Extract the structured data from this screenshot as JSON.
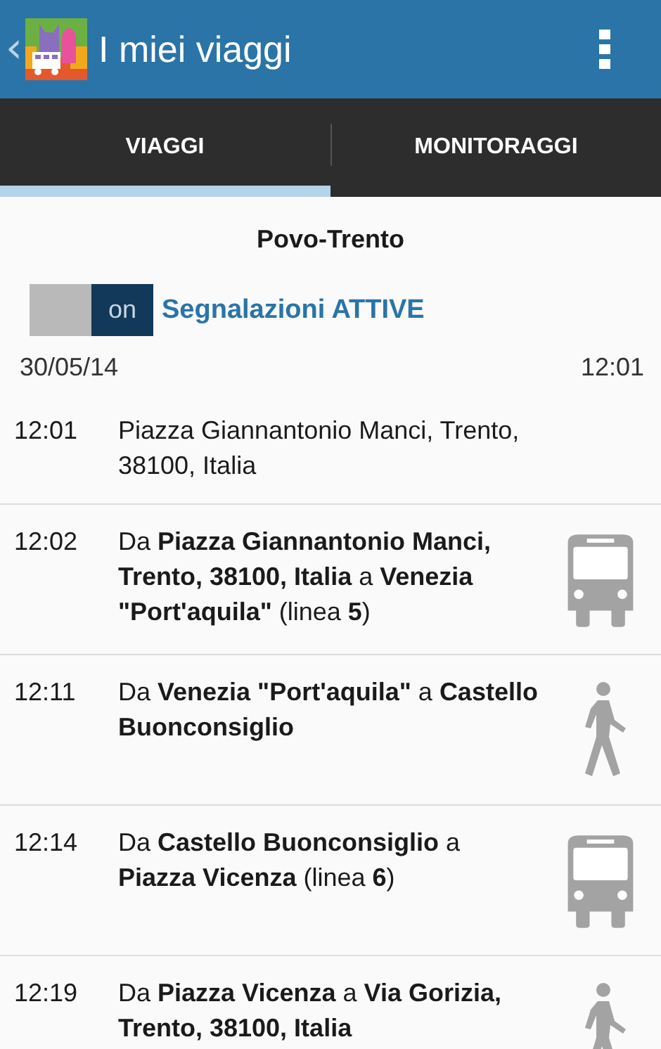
{
  "app_bar": {
    "back": "‹",
    "title": "I miei viaggi"
  },
  "tabs": [
    {
      "label": "VIAGGI",
      "selected": true
    },
    {
      "label": "MONITORAGGI",
      "selected": false
    }
  ],
  "trip": {
    "title": "Povo-Trento",
    "alerts": {
      "on": true,
      "switch_label": "on",
      "label": "Segnalazioni ATTIVE"
    },
    "date": "30/05/14",
    "time": "12:01"
  },
  "steps": [
    {
      "time": "12:01",
      "kind": "start",
      "text": "Piazza Giannantonio Manci, Trento, 38100, Italia"
    },
    {
      "time": "12:02",
      "kind": "bus",
      "text": "Da **Piazza Giannantonio Manci, Trento, 38100, Italia** a **Venezia \"Port'aquila\"** (linea **5**)"
    },
    {
      "time": "12:11",
      "kind": "walk",
      "text": "Da **Venezia \"Port'aquila\"** a **Castello Buonconsiglio**"
    },
    {
      "time": "12:14",
      "kind": "bus",
      "text": "Da **Castello Buonconsiglio** a **Piazza Vicenza** (linea **6**)"
    },
    {
      "time": "12:19",
      "kind": "walk",
      "text": "Da **Piazza Vicenza** a **Via Gorizia, Trento, 38100, Italia**"
    }
  ]
}
